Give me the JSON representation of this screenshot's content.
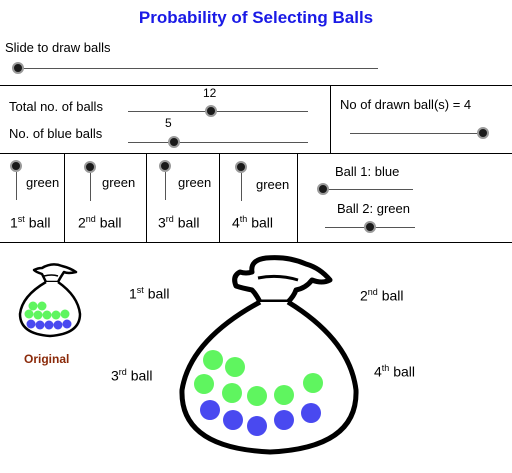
{
  "title": "Probability of Selecting Balls",
  "draw_slider": {
    "label": "Slide to draw balls",
    "level": 0
  },
  "total_slider": {
    "label": "Total no. of balls",
    "value": "12"
  },
  "blue_slider": {
    "label": "No. of blue balls",
    "value": "5"
  },
  "drawn_slider": {
    "label": "No of drawn ball(s) = 4"
  },
  "draw_columns": [
    {
      "color": "green",
      "num": "1",
      "suffix": "st",
      "word": "ball"
    },
    {
      "color": "green",
      "num": "2",
      "suffix": "nd",
      "word": "ball"
    },
    {
      "color": "green",
      "num": "3",
      "suffix": "rd",
      "word": "ball"
    },
    {
      "color": "green",
      "num": "4",
      "suffix": "th",
      "word": "ball"
    }
  ],
  "results": [
    {
      "label": "Ball 1: blue"
    },
    {
      "label": "Ball 2: green"
    }
  ],
  "original_label": "Original",
  "bag_slots": [
    {
      "num": "1",
      "suffix": "st",
      "word": "ball"
    },
    {
      "num": "2",
      "suffix": "nd",
      "word": "ball"
    },
    {
      "num": "3",
      "suffix": "rd",
      "word": "ball"
    },
    {
      "num": "4",
      "suffix": "th",
      "word": "ball"
    }
  ],
  "colors": {
    "title": "#1a1ae6",
    "green": "#5ff55f",
    "blue": "#4949f0",
    "original": "#8b2a0a"
  }
}
